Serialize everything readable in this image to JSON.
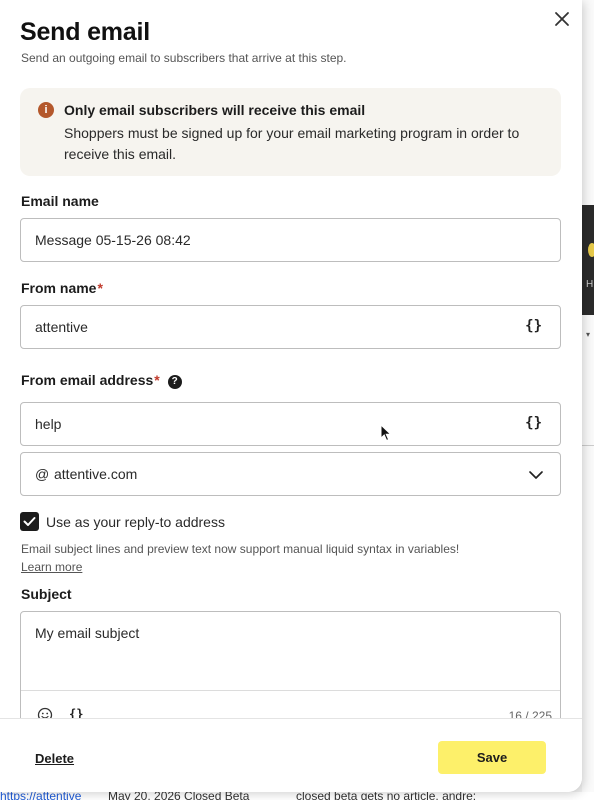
{
  "modal": {
    "title": "Send email",
    "subtitle": "Send an outgoing email to subscribers that arrive at this step.",
    "close_icon": "close-icon"
  },
  "notice": {
    "icon": "info-icon",
    "icon_glyph": "i",
    "title": "Only email subscribers will receive this email",
    "body": "Shoppers must be signed up for your email marketing program in order to receive this email."
  },
  "email_name": {
    "label": "Email name",
    "value": "Message 05-15-26 08:42"
  },
  "from_name": {
    "label": "From name",
    "required_mark": "*",
    "value": "attentive",
    "variable_glyph": "{}"
  },
  "from_email": {
    "label": "From email address",
    "required_mark": "*",
    "help_glyph": "?",
    "value": "help",
    "variable_glyph": "{}",
    "at_symbol": "@",
    "domain": "attentive.com"
  },
  "reply_to": {
    "checked": true,
    "label": "Use as your reply-to address"
  },
  "note": {
    "text": "Email subject lines and preview text now support manual liquid syntax in variables!",
    "link": "Learn more"
  },
  "subject": {
    "label": "Subject",
    "value": "My email subject",
    "variable_glyph": "{}",
    "counter": "16 / 225"
  },
  "footer": {
    "delete_label": "Delete",
    "save_label": "Save"
  },
  "background": {
    "bottom_link": "https://attentive",
    "bottom_text_1": "May 20, 2026 Closed Beta",
    "bottom_text_2": "closed beta gets no article, andre:",
    "side_letter": "H"
  },
  "colors": {
    "save_button": "#fdf06a",
    "notice_bg": "#f6f4ef",
    "info_icon": "#b4582c",
    "required": "#c0392b"
  }
}
